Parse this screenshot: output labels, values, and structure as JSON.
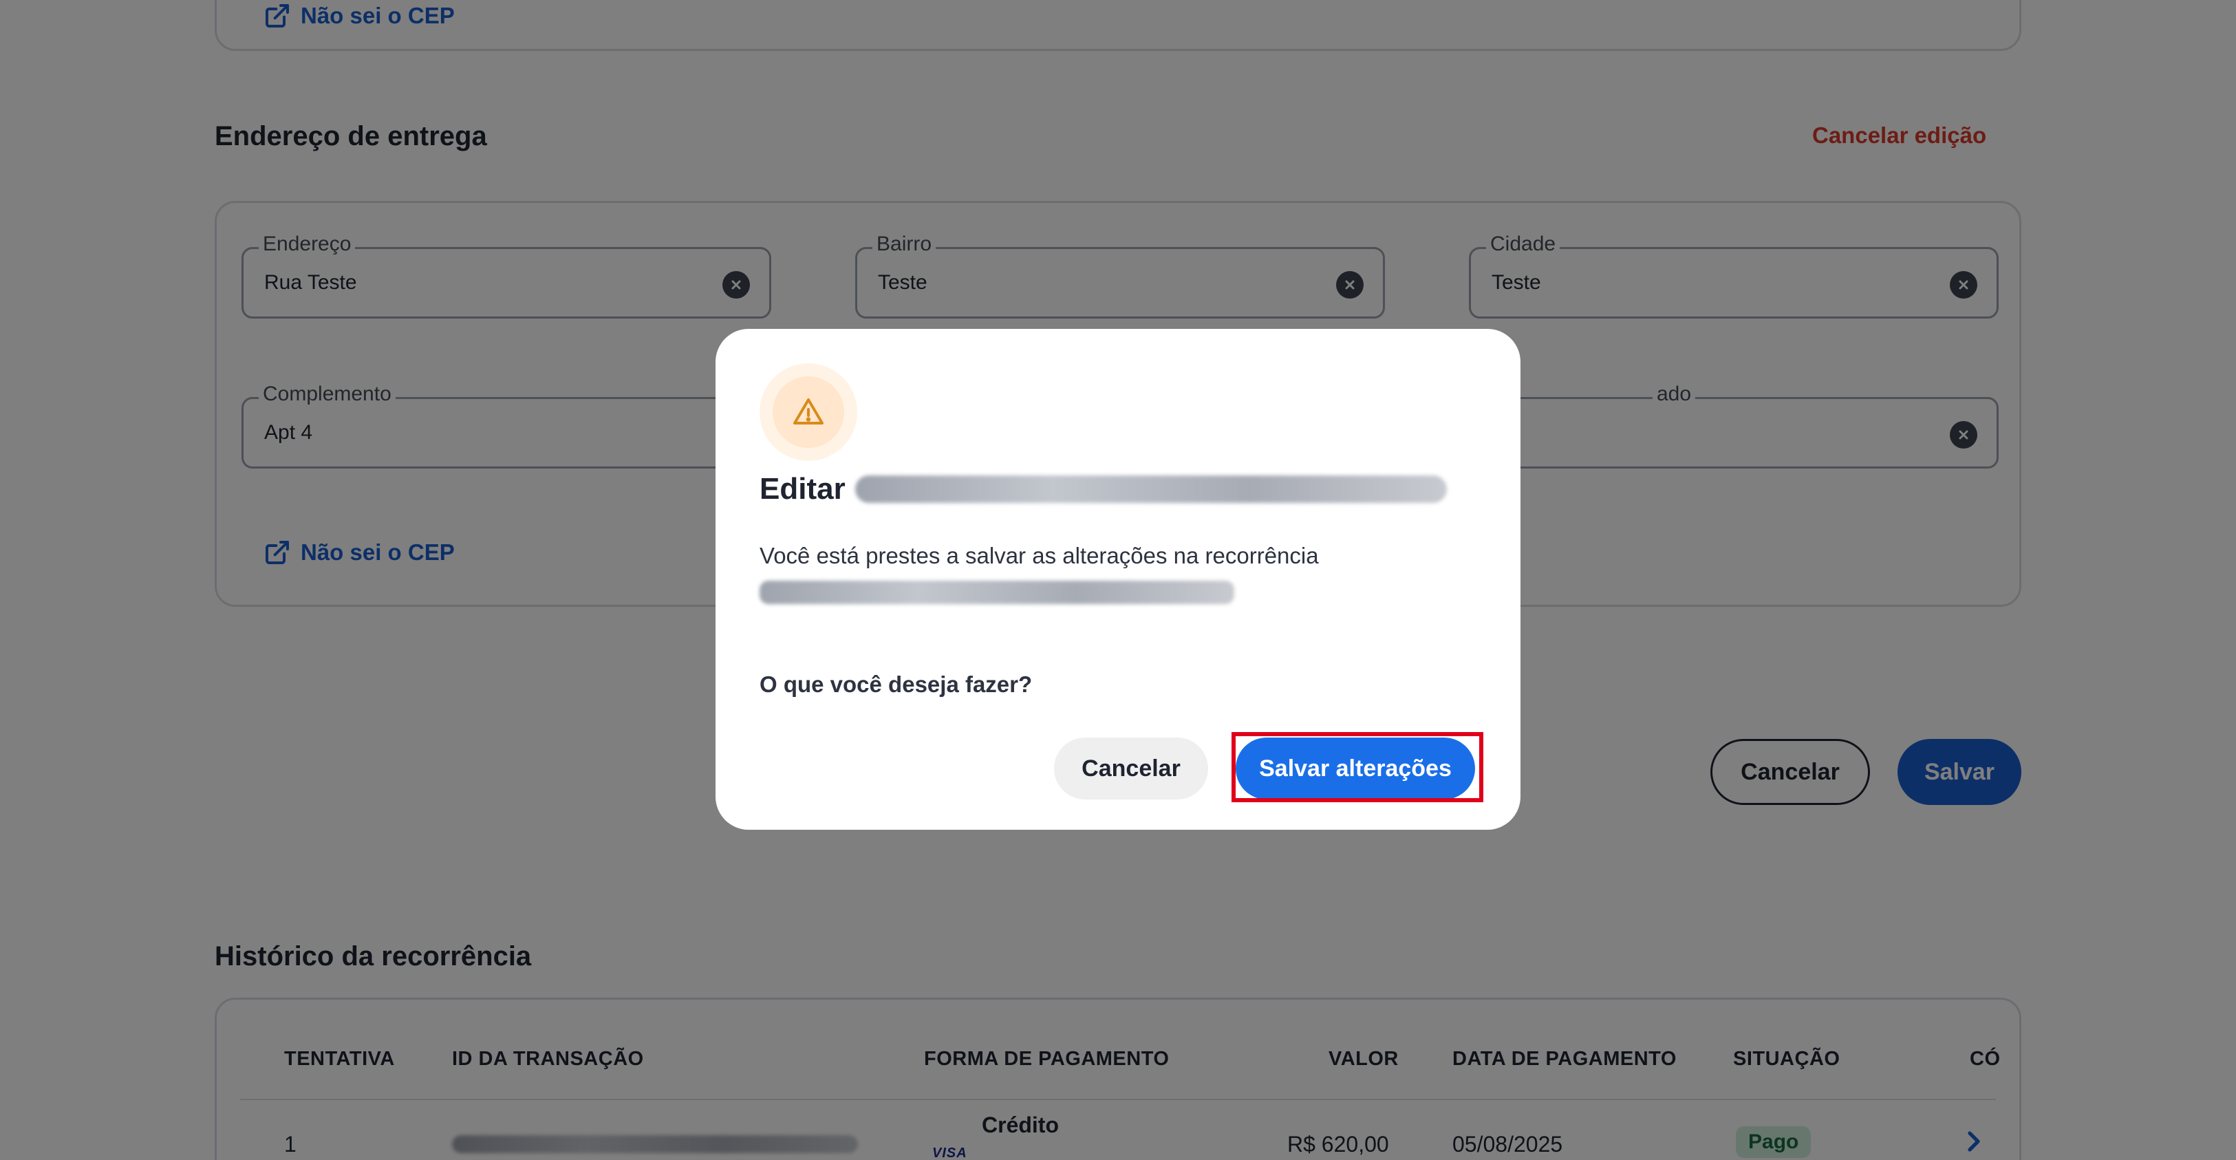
{
  "top_card": {
    "link_label": "Não sei o CEP"
  },
  "shipping": {
    "title": "Endereço de entrega",
    "cancel_edit_label": "Cancelar edição",
    "fields": {
      "endereco": {
        "label": "Endereço",
        "value": "Rua Teste"
      },
      "bairro": {
        "label": "Bairro",
        "value": "Teste"
      },
      "cidade": {
        "label": "Cidade",
        "value": "Teste"
      },
      "complemento": {
        "label": "Complemento",
        "value": "Apt 4"
      },
      "estado": {
        "label": "ado",
        "value": ""
      }
    },
    "cep_link_label": "Não sei o CEP"
  },
  "page_actions": {
    "cancel_label": "Cancelar",
    "save_label": "Salvar"
  },
  "history": {
    "title": "Histórico da recorrência",
    "columns": [
      "TENTATIVA",
      "ID DA TRANSAÇÃO",
      "FORMA DE PAGAMENTO",
      "VALOR",
      "DATA DE PAGAMENTO",
      "SITUAÇÃO",
      "CÓ"
    ],
    "rows": [
      {
        "attempt": "1",
        "card_brand": "VISA",
        "payment_method": "Crédito",
        "value": "R$ 620,00",
        "payment_date": "05/08/2025",
        "status": "Pago"
      }
    ]
  },
  "modal": {
    "title_prefix": "Editar",
    "message": "Você está prestes a salvar as alterações na recorrência",
    "question": "O que você deseja fazer?",
    "cancel_label": "Cancelar",
    "save_label": "Salvar alterações"
  },
  "colors": {
    "primary": "#1a5fd0",
    "modal_primary": "#1a6fe8",
    "danger": "#d93a2b",
    "highlight": "#e0001a",
    "warning": "#d98a1c"
  },
  "icons": {
    "external_link": "external-link-icon",
    "clear": "clear-circle-icon",
    "warning": "warning-triangle-icon",
    "chevron": "chevron-right-icon"
  }
}
